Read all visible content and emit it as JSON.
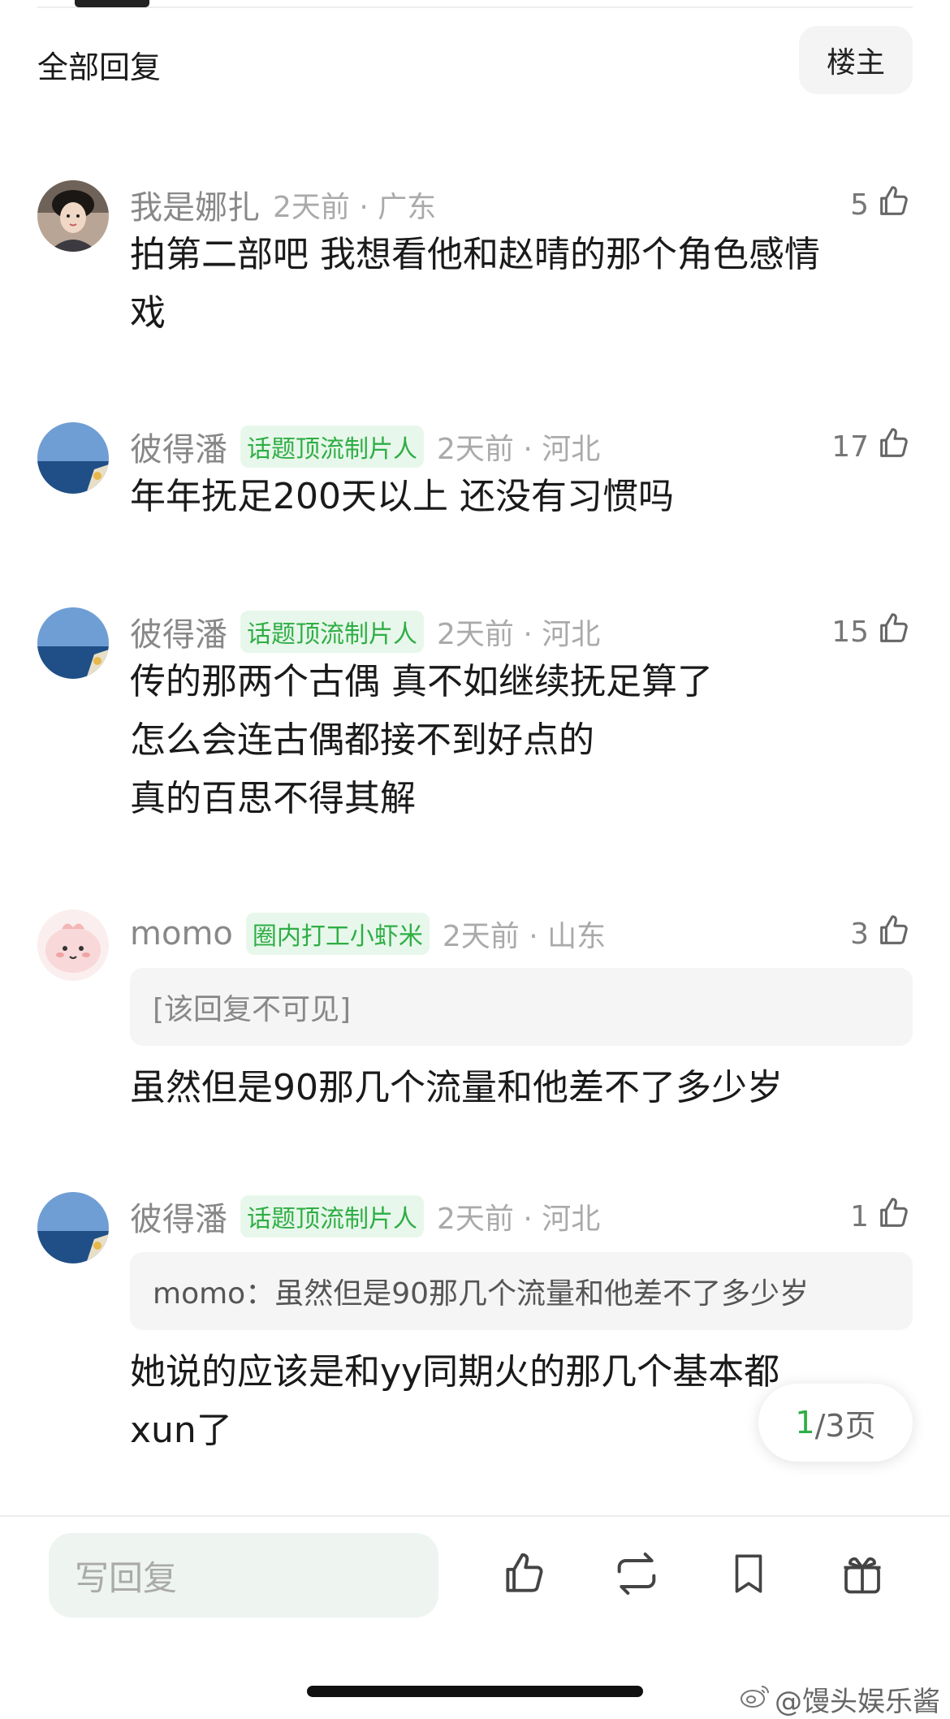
{
  "header": {
    "title": "全部回复",
    "filter_label": "楼主"
  },
  "comments": [
    {
      "username": "我是娜扎",
      "badge": "",
      "time_loc": "2天前 · 广东",
      "likes": "5",
      "lines": [
        "拍第二部吧 我想看他和赵晴的那个角色感情",
        "戏"
      ]
    },
    {
      "username": "彼得潘",
      "badge": "话题顶流制片人",
      "time_loc": "2天前 · 河北",
      "likes": "17",
      "lines": [
        "年年抚足200天以上  还没有习惯吗"
      ]
    },
    {
      "username": "彼得潘",
      "badge": "话题顶流制片人",
      "time_loc": "2天前 · 河北",
      "likes": "15",
      "lines": [
        "传的那两个古偶   真不如继续抚足算了",
        "怎么会连古偶都接不到好点的",
        "真的百思不得其解"
      ]
    },
    {
      "username": "momo",
      "badge": "圈内打工小虾米",
      "time_loc": "2天前 · 山东",
      "likes": "3",
      "quote": "[该回复不可见]",
      "lines": [
        "虽然但是90那几个流量和他差不了多少岁"
      ]
    },
    {
      "username": "彼得潘",
      "badge": "话题顶流制片人",
      "time_loc": "2天前 · 河北",
      "likes": "1",
      "quote": "momo：虽然但是90那几个流量和他差不了多少岁",
      "lines": [
        "她说的应该是和yy同期火的那几个基本都",
        "xun了"
      ]
    }
  ],
  "pagination": {
    "current": "1",
    "total": "/3页"
  },
  "footer": {
    "reply_placeholder": "写回复",
    "icons": [
      "thumbs-up-icon",
      "repost-icon",
      "bookmark-icon",
      "gift-icon"
    ]
  },
  "watermark": "@馒头娱乐酱",
  "colors": {
    "accent_green": "#2fae45",
    "badge_bg": "#e8f7eb",
    "muted": "#aaaaaa"
  }
}
